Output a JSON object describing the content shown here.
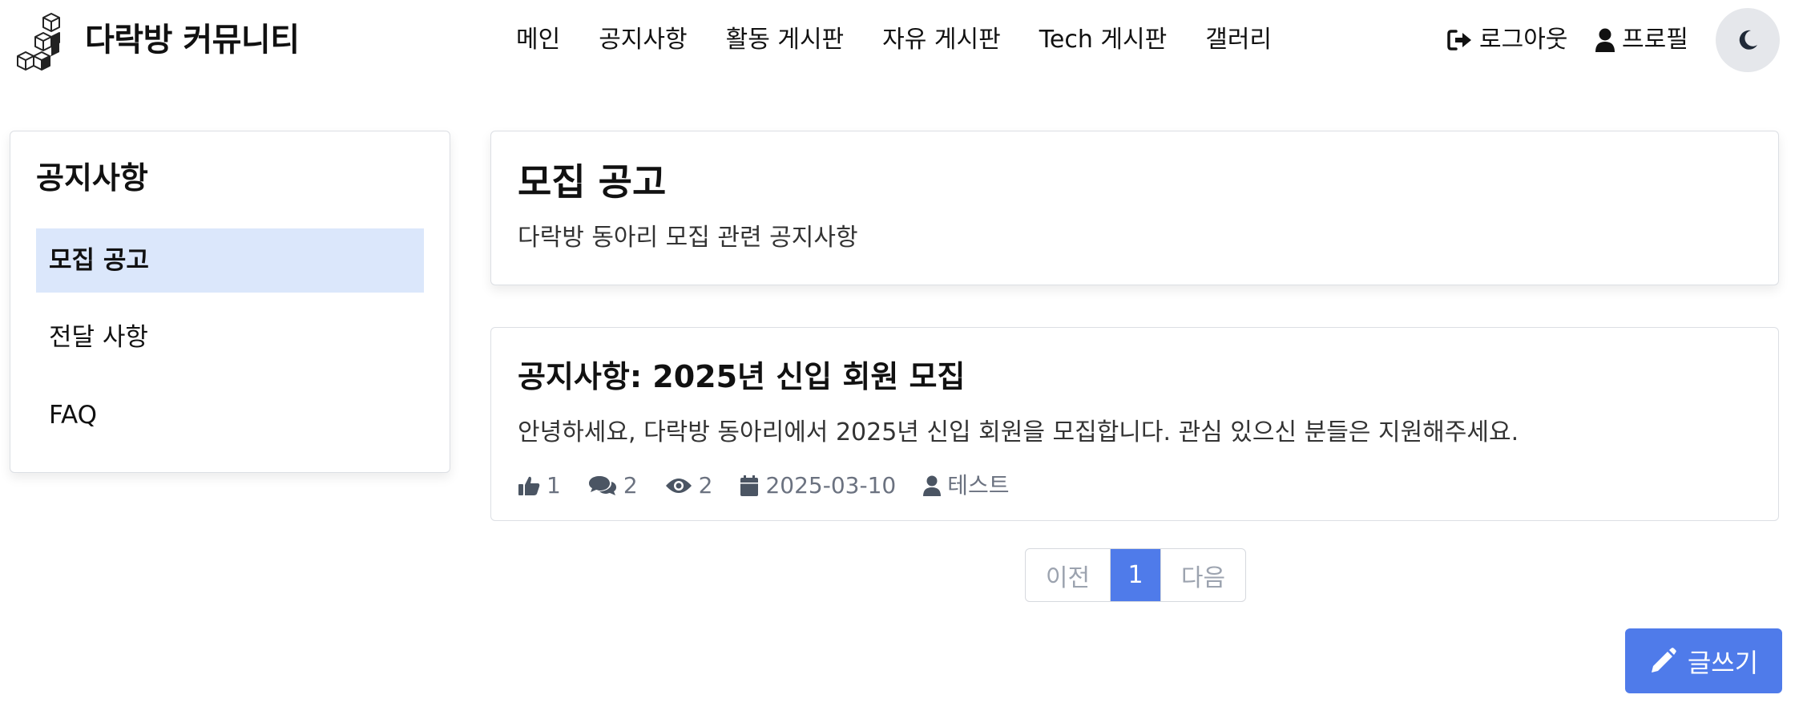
{
  "brand": {
    "name": "다락방 커뮤니티",
    "logo_icon": "stacked-cubes-icon"
  },
  "nav": {
    "items": [
      "메인",
      "공지사항",
      "활동 게시판",
      "자유 게시판",
      "Tech 게시판",
      "갤러리"
    ]
  },
  "user_menu": {
    "logout_label": "로그아웃",
    "logout_icon": "sign-out-icon",
    "profile_label": "프로필",
    "profile_icon": "user-icon",
    "theme_icon": "moon-icon"
  },
  "sidebar": {
    "title": "공지사항",
    "items": [
      {
        "label": "모집 공고",
        "active": true
      },
      {
        "label": "전달 사항",
        "active": false
      },
      {
        "label": "FAQ",
        "active": false
      }
    ]
  },
  "category": {
    "title": "모집 공고",
    "description": "다락방 동아리 모집 관련 공지사항"
  },
  "posts": [
    {
      "title": "공지사항: 2025년 신입 회원 모집",
      "excerpt": "안녕하세요, 다락방 동아리에서 2025년 신입 회원을 모집합니다. 관심 있으신 분들은 지원해주세요.",
      "likes": "1",
      "comments": "2",
      "views": "2",
      "date": "2025-03-10",
      "author": "테스트"
    }
  ],
  "pagination": {
    "prev": "이전",
    "current": "1",
    "next": "다음"
  },
  "write_button": {
    "label": "글쓰기",
    "icon": "pencil-icon"
  },
  "colors": {
    "accent": "#4f7bea",
    "sidebar_active_bg": "#dbe7fb",
    "meta_text": "#6b7280",
    "theme_toggle_bg": "#e5e7eb"
  }
}
